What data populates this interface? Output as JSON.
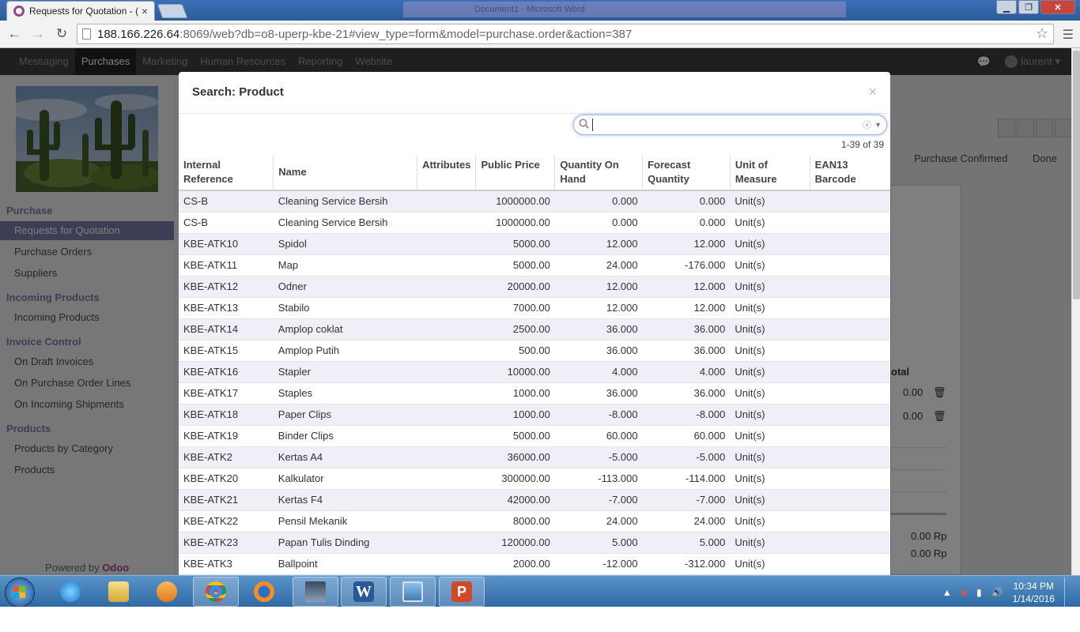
{
  "browser": {
    "tab_title": "Requests for Quotation - (",
    "url_host": "188.166.226.64",
    "url_rest": ":8069/web?db=o8-uperp-kbe-21#view_type=form&model=purchase.order&action=387",
    "background_window_title": "Document1 - Microsoft Word"
  },
  "odoo": {
    "menu": [
      "Messaging",
      "Purchases",
      "Marketing",
      "Human Resources",
      "Reporting",
      "Website"
    ],
    "active_menu": "Purchases",
    "user": "laurent",
    "sidebar": {
      "purchase_heading": "Purchase",
      "purchase_items": [
        "Requests for Quotation",
        "Purchase Orders",
        "Suppliers"
      ],
      "incoming_heading": "Incoming Products",
      "incoming_items": [
        "Incoming Products"
      ],
      "invoice_heading": "Invoice Control",
      "invoice_items": [
        "On Draft Invoices",
        "On Purchase Order Lines",
        "On Incoming Shipments"
      ],
      "products_heading": "Products",
      "products_items": [
        "Products by Category",
        "Products"
      ],
      "powered_by": "Powered by",
      "powered_brand": "Odoo"
    },
    "background": {
      "stage_confirmed": "Purchase Confirmed",
      "stage_done": "Done",
      "total_header": "otal",
      "line_amount_1": "0.00",
      "line_amount_2": "0.00",
      "total_1": "0.00 Rp",
      "total_2": "0.00 Rp"
    }
  },
  "modal": {
    "title": "Search: Product",
    "close": "×",
    "search_value": "",
    "pager": "1-39 of 39",
    "columns": [
      "Internal Reference",
      "Name",
      "Attributes",
      "Public Price",
      "Quantity On Hand",
      "Forecast Quantity",
      "Unit of Measure",
      "EAN13 Barcode"
    ],
    "rows": [
      [
        "CS-B",
        "Cleaning Service Bersih",
        "",
        "1000000.00",
        "0.000",
        "0.000",
        "Unit(s)",
        ""
      ],
      [
        "CS-B",
        "Cleaning Service Bersih",
        "",
        "1000000.00",
        "0.000",
        "0.000",
        "Unit(s)",
        ""
      ],
      [
        "KBE-ATK10",
        "Spidol",
        "",
        "5000.00",
        "12.000",
        "12.000",
        "Unit(s)",
        ""
      ],
      [
        "KBE-ATK11",
        "Map",
        "",
        "5000.00",
        "24.000",
        "-176.000",
        "Unit(s)",
        ""
      ],
      [
        "KBE-ATK12",
        "Odner",
        "",
        "20000.00",
        "12.000",
        "12.000",
        "Unit(s)",
        ""
      ],
      [
        "KBE-ATK13",
        "Stabilo",
        "",
        "7000.00",
        "12.000",
        "12.000",
        "Unit(s)",
        ""
      ],
      [
        "KBE-ATK14",
        "Amplop coklat",
        "",
        "2500.00",
        "36.000",
        "36.000",
        "Unit(s)",
        ""
      ],
      [
        "KBE-ATK15",
        "Amplop Putih",
        "",
        "500.00",
        "36.000",
        "36.000",
        "Unit(s)",
        ""
      ],
      [
        "KBE-ATK16",
        "Stapler",
        "",
        "10000.00",
        "4.000",
        "4.000",
        "Unit(s)",
        ""
      ],
      [
        "KBE-ATK17",
        "Staples",
        "",
        "1000.00",
        "36.000",
        "36.000",
        "Unit(s)",
        ""
      ],
      [
        "KBE-ATK18",
        "Paper Clips",
        "",
        "1000.00",
        "-8.000",
        "-8.000",
        "Unit(s)",
        ""
      ],
      [
        "KBE-ATK19",
        "Binder Clips",
        "",
        "5000.00",
        "60.000",
        "60.000",
        "Unit(s)",
        ""
      ],
      [
        "KBE-ATK2",
        "Kertas A4",
        "",
        "36000.00",
        "-5.000",
        "-5.000",
        "Unit(s)",
        ""
      ],
      [
        "KBE-ATK20",
        "Kalkulator",
        "",
        "300000.00",
        "-113.000",
        "-114.000",
        "Unit(s)",
        ""
      ],
      [
        "KBE-ATK21",
        "Kertas F4",
        "",
        "42000.00",
        "-7.000",
        "-7.000",
        "Unit(s)",
        ""
      ],
      [
        "KBE-ATK22",
        "Pensil Mekanik",
        "",
        "8000.00",
        "24.000",
        "24.000",
        "Unit(s)",
        ""
      ],
      [
        "KBE-ATK23",
        "Papan Tulis Dinding",
        "",
        "120000.00",
        "5.000",
        "5.000",
        "Unit(s)",
        ""
      ],
      [
        "KBE-ATK3",
        "Ballpoint",
        "",
        "2000.00",
        "-12.000",
        "-312.000",
        "Unit(s)",
        ""
      ]
    ]
  },
  "taskbar": {
    "apps": [
      "internet-explorer",
      "file-explorer",
      "media-player",
      "chrome",
      "firefox",
      "computer-app",
      "word",
      "photo-viewer",
      "powerpoint"
    ],
    "time": "10:34 PM",
    "date": "1/14/2016"
  },
  "colors": {
    "odoo_accent": "#7c7bad",
    "odoo_topbar": "#3e3e3e",
    "row_stripe": "#efeff8"
  }
}
